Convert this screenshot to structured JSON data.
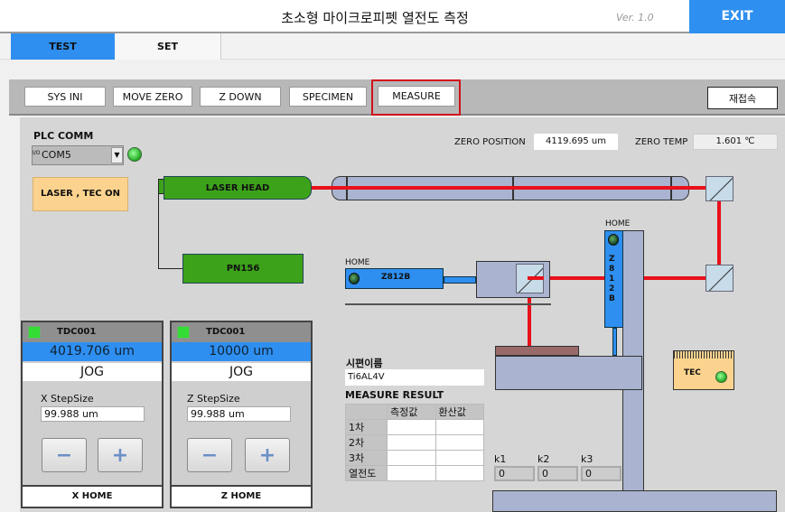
{
  "header": {
    "title": "초소형 마이크로피펫 열전도 측정",
    "version": "Ver. 1.0",
    "exit_label": "EXIT"
  },
  "tabs": [
    {
      "label": "TEST",
      "active": true
    },
    {
      "label": "SET",
      "active": false
    }
  ],
  "toolbar": {
    "buttons": [
      "SYS INI",
      "MOVE ZERO",
      "Z DOWN",
      "SPECIMEN",
      "MEASURE"
    ],
    "highlighted": "MEASURE",
    "reconnect": "재접속"
  },
  "plc": {
    "label": "PLC COMM",
    "port": "COM5",
    "io_prefix": "I/O"
  },
  "laser_button": "LASER , TEC ON",
  "zero": {
    "position_label": "ZERO POSITION",
    "position_value": "4119.695 um",
    "temp_label": "ZERO TEMP",
    "temp_value": "1.601 ℃"
  },
  "diagram": {
    "laser_head": "LASER HEAD",
    "pn": "PN156",
    "x_stage": "Z812B",
    "z_stage": "Z812B",
    "home": "HOME",
    "tec": "TEC"
  },
  "x_panel": {
    "title": "TDC001",
    "value": "4019.706 um",
    "jog": "JOG",
    "step_label": "X StepSize",
    "step_value": "99.988 um",
    "minus": "−",
    "plus": "+",
    "home": "X HOME"
  },
  "z_panel": {
    "title": "TDC001",
    "value": "10000 um",
    "jog": "JOG",
    "step_label": "Z StepSize",
    "step_value": "99.988 um",
    "minus": "−",
    "plus": "+",
    "home": "Z HOME"
  },
  "specimen": {
    "label": "시편이름",
    "value": "Ti6AL4V"
  },
  "result": {
    "title": "MEASURE RESULT",
    "columns": [
      "",
      "측정값",
      "환산값"
    ],
    "rows": [
      [
        "1차",
        "",
        ""
      ],
      [
        "2차",
        "",
        ""
      ],
      [
        "3차",
        "",
        ""
      ],
      [
        "열전도",
        "",
        ""
      ]
    ]
  },
  "k": [
    {
      "label": "k1",
      "value": "0"
    },
    {
      "label": "k2",
      "value": "0"
    },
    {
      "label": "k3",
      "value": "0"
    }
  ],
  "colors": {
    "accent": "#2e8ff0",
    "laser": "#e8101a",
    "green": "#3ca21a",
    "highlight": "#d0101a"
  }
}
